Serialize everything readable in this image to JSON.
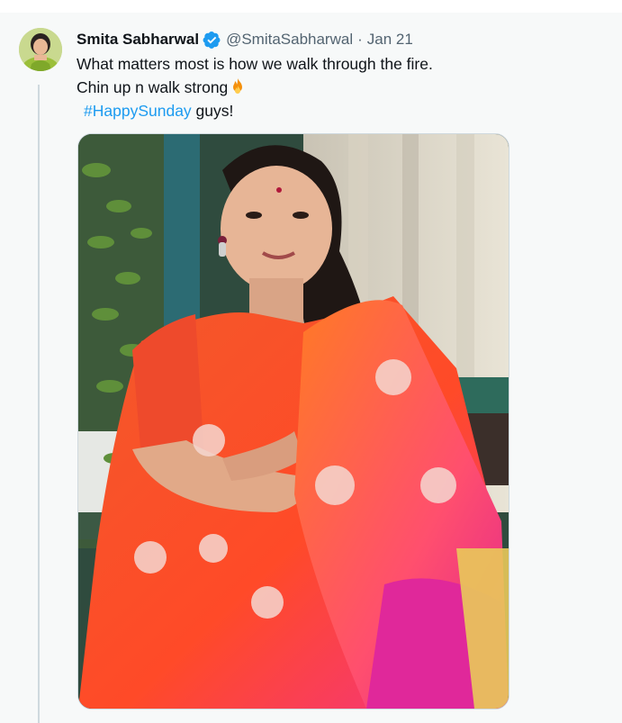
{
  "tweet": {
    "author_name": "Smita Sabharwal",
    "handle": "@SmitaSabharwal",
    "separator": "·",
    "date": "Jan 21",
    "text_line1": "What matters most is how we walk through the fire.",
    "text_line2": "Chin up n walk strong",
    "hashtag": "#HappySunday",
    "text_after_hashtag": " guys!",
    "verified": true
  },
  "icons": {
    "verified": "verified-badge-icon",
    "emoji": "fire-emoji-icon"
  },
  "colors": {
    "background": "#f7f9f9",
    "name": "#0f1419",
    "secondary": "#536471",
    "hashtag": "#1d9bf0",
    "verified": "#1d9bf0",
    "thread_line": "#cfd9de"
  },
  "media": {
    "type": "photo"
  }
}
